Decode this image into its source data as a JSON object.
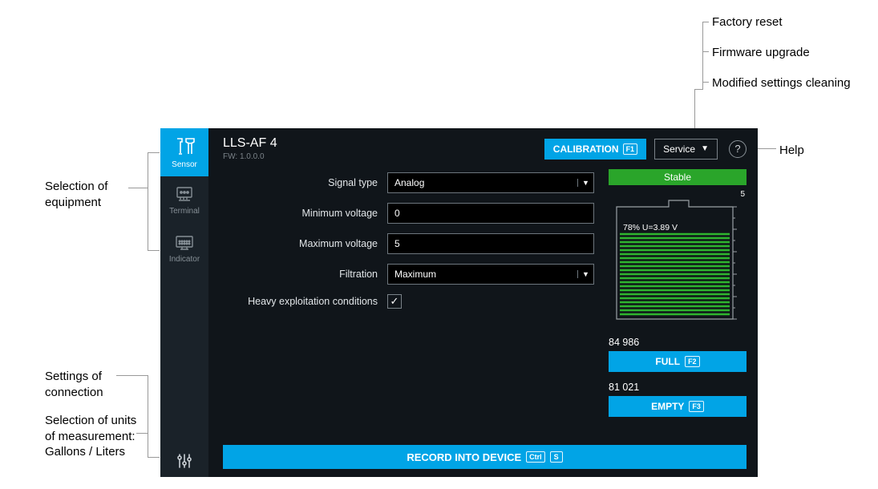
{
  "annotations": {
    "factory_reset": "Factory reset",
    "firmware_upgrade": "Firmware upgrade",
    "modified_cleaning": "Modified settings cleaning",
    "help": "Help",
    "selection_equipment": "Selection of equipment",
    "settings_connection": "Settings of connection",
    "selection_units": "Selection of units of measurement: Gallons / Liters"
  },
  "sidebar": {
    "sensor": "Sensor",
    "terminal": "Terminal",
    "indicator": "Indicator"
  },
  "header": {
    "title": "LLS-AF 4",
    "fw_prefix": "FW:",
    "fw_value": "1.0.0.0",
    "calibration": "CALIBRATION",
    "calibration_key": "F1",
    "service": "Service"
  },
  "form": {
    "signal_type_label": "Signal type",
    "signal_type_value": "Analog",
    "min_voltage_label": "Minimum voltage",
    "min_voltage_value": "0",
    "max_voltage_label": "Maximum voltage",
    "max_voltage_value": "5",
    "filtration_label": "Filtration",
    "filtration_value": "Maximum",
    "heavy_label": "Heavy exploitation conditions",
    "heavy_checked": true
  },
  "right": {
    "stable": "Stable",
    "scale_top": "5",
    "tank_reading": "78% U=3.89 V",
    "full_value": "84 986",
    "full_label": "FULL",
    "full_key": "F2",
    "empty_value": "81 021",
    "empty_label": "EMPTY",
    "empty_key": "F3"
  },
  "footer": {
    "record": "RECORD INTO DEVICE",
    "record_key1": "Ctrl",
    "record_key2": "S"
  }
}
